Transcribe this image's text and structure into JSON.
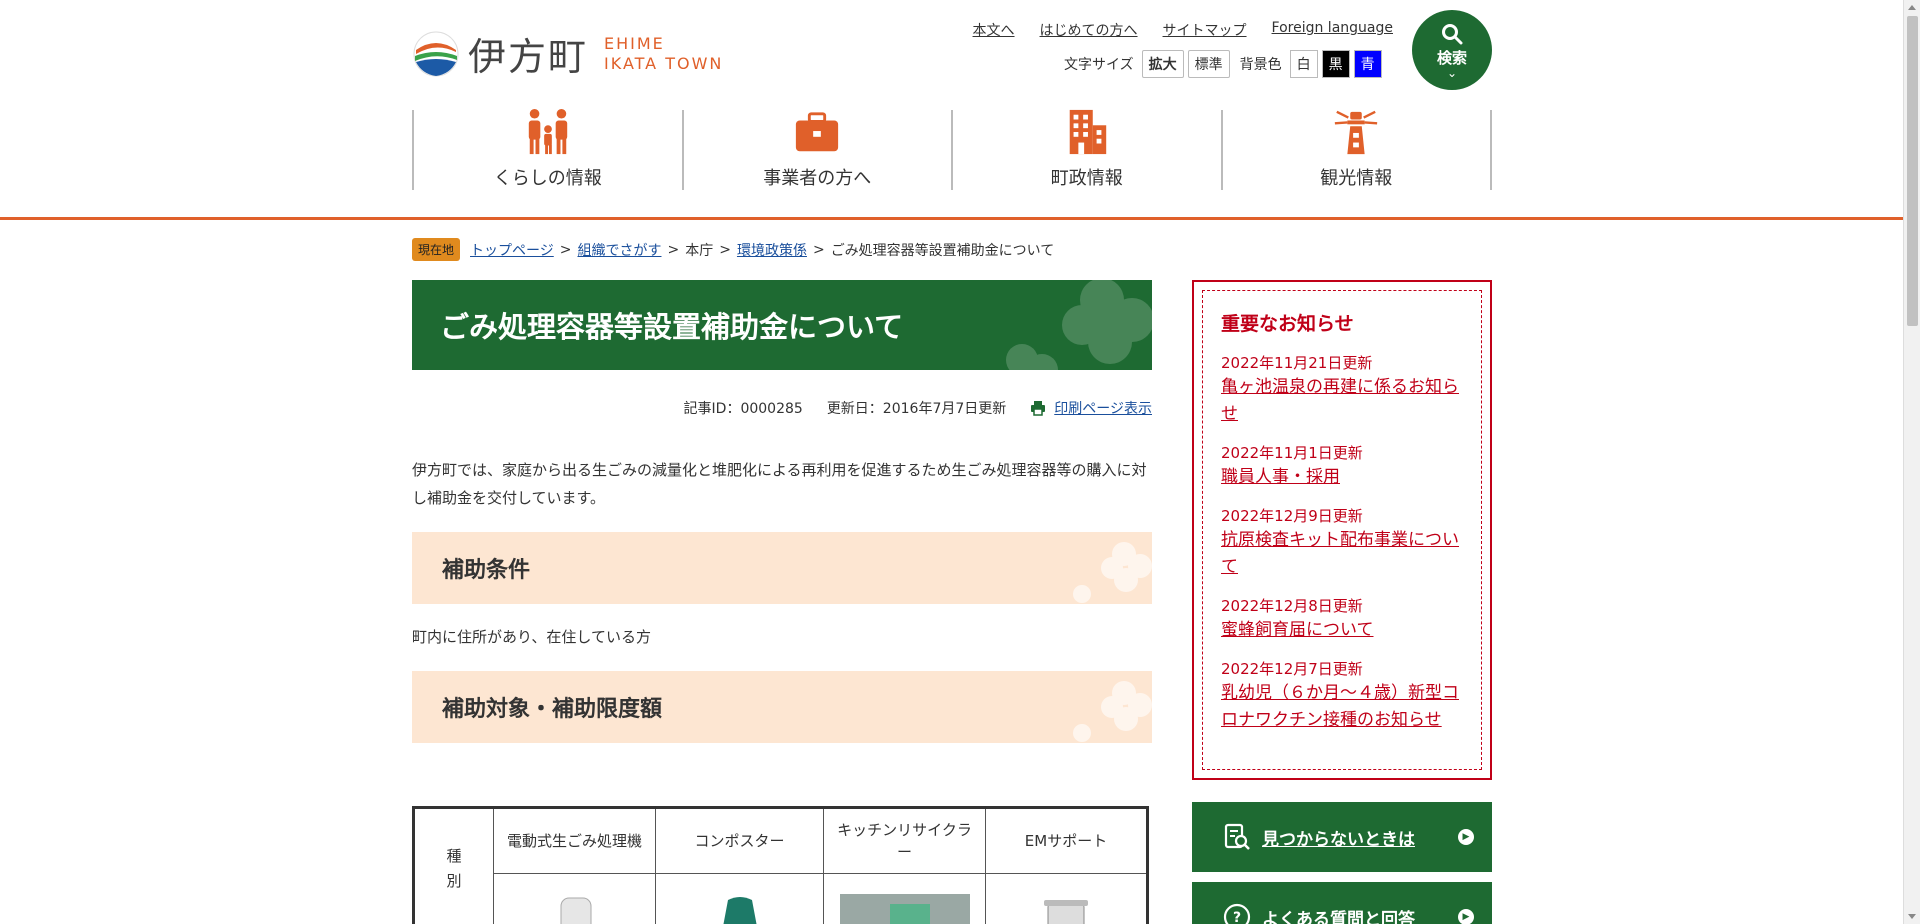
{
  "header": {
    "logo_jp": "伊方町",
    "logo_en_1": "EHIME",
    "logo_en_2": "IKATA TOWN",
    "util_links": [
      "本文へ",
      "はじめての方へ",
      "サイトマップ",
      "Foreign language"
    ],
    "font_size_label": "文字サイズ",
    "font_large": "拡大",
    "font_normal": "標準",
    "bg_label": "背景色",
    "bg_white": "白",
    "bg_black": "黒",
    "bg_blue": "青",
    "search_label": "検索",
    "nav": [
      "くらしの情報",
      "事業者の方へ",
      "町政情報",
      "観光情報"
    ]
  },
  "breadcrumb": {
    "here": "現在地",
    "items": [
      "トップページ",
      "組織でさがす",
      "本庁",
      "環境政策係",
      "ごみ処理容器等設置補助金について"
    ]
  },
  "main": {
    "title": "ごみ処理容器等設置補助金について",
    "article_id": "記事ID：0000285",
    "updated": "更新日：2016年7月7日更新",
    "print_label": "印刷ページ表示",
    "intro": "伊方町では、家庭から出る生ごみの減量化と堆肥化による再利用を促進するため生ごみ処理容器等の購入に対し補助金を交付しています。",
    "h2_conditions": "補助条件",
    "conditions_text": "町内に住所があり、在住している方",
    "h2_target": "補助対象・補助限度額",
    "table": {
      "row_header": "種別",
      "columns": [
        "電動式生ごみ処理機",
        "コンポスター",
        "キッチンリサイクラー",
        "EMサポート"
      ]
    }
  },
  "sidebar": {
    "notice_title": "重要なお知らせ",
    "notices": [
      {
        "date": "2022年11月21日更新",
        "title": "亀ヶ池温泉の再建に係るお知らせ"
      },
      {
        "date": "2022年11月1日更新",
        "title": "職員人事・採用"
      },
      {
        "date": "2022年12月9日更新",
        "title": "抗原検査キット配布事業について"
      },
      {
        "date": "2022年12月8日更新",
        "title": "蜜蜂飼育届について"
      },
      {
        "date": "2022年12月7日更新",
        "title": "乳幼児（６か月～４歳）新型コロナワクチン接種のお知らせ"
      }
    ],
    "btn_notfound": "見つからないときは",
    "btn_faq": "よくある質問と回答"
  },
  "colors": {
    "brand_green": "#1e6a32",
    "accent_orange": "#e0602a",
    "notice_red": "#c00018",
    "heading_bg": "#fde6d2"
  }
}
